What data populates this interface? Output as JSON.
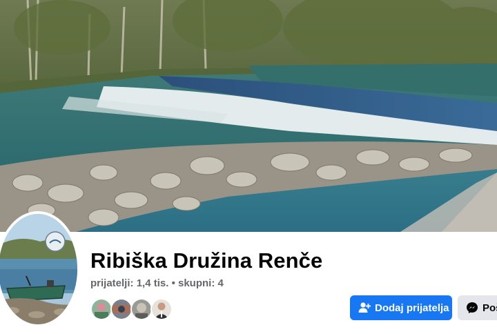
{
  "page": {
    "name": "Ribiška Družina Renče",
    "friends_label": "prijatelji:",
    "friends_count": "1,4 tis.",
    "separator": "•",
    "groups_label": "skupni:",
    "groups_count": "4"
  },
  "actions": {
    "add_friend_label": "Dodaj prijatelja",
    "message_label": "Pošlji sporočilo"
  },
  "icons": {
    "add_friend": "add-friend-icon",
    "message": "messenger-icon"
  },
  "colors": {
    "primary": "#1877f2",
    "secondary_bg": "#e4e6eb",
    "muted_text": "#65676b"
  }
}
